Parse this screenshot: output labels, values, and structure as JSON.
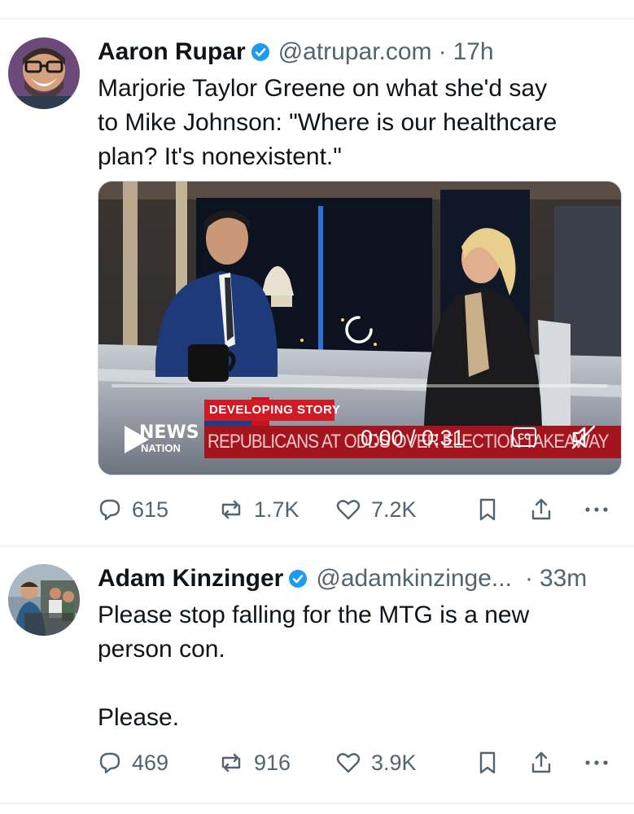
{
  "tweets": [
    {
      "author": "Aaron Rupar",
      "handle": "@atrupar.com",
      "separator": "·",
      "time": "17h",
      "text": "Marjorie Taylor Greene on what she'd say\nto Mike Johnson: \"Where is our healthcare\nplan? It's nonexistent.\"",
      "video": {
        "chyron_tag": "DEVELOPING STORY",
        "chyron_text": "REPUBLICANS AT ODDS OVER ELECTION TAKEAWAY",
        "network_top": "NEWS",
        "network_bottom": "NATION",
        "timestamp": "0:00 / 0:31",
        "cc_label": "CC"
      },
      "stats": {
        "replies": "615",
        "reposts": "1.7K",
        "likes": "7.2K"
      }
    },
    {
      "author": "Adam Kinzinger",
      "handle": "@adamkinzinge...",
      "separator": "·",
      "time": "33m",
      "text": "Please stop falling for the MTG is a new\nperson con.\n\nPlease.",
      "stats": {
        "replies": "469",
        "reposts": "916",
        "likes": "3.9K"
      }
    }
  ],
  "colors": {
    "verified": "#1d9bf0",
    "muted": "#536471",
    "chyron_red": "#a3141c",
    "chyron_tag": "#d11a24"
  }
}
